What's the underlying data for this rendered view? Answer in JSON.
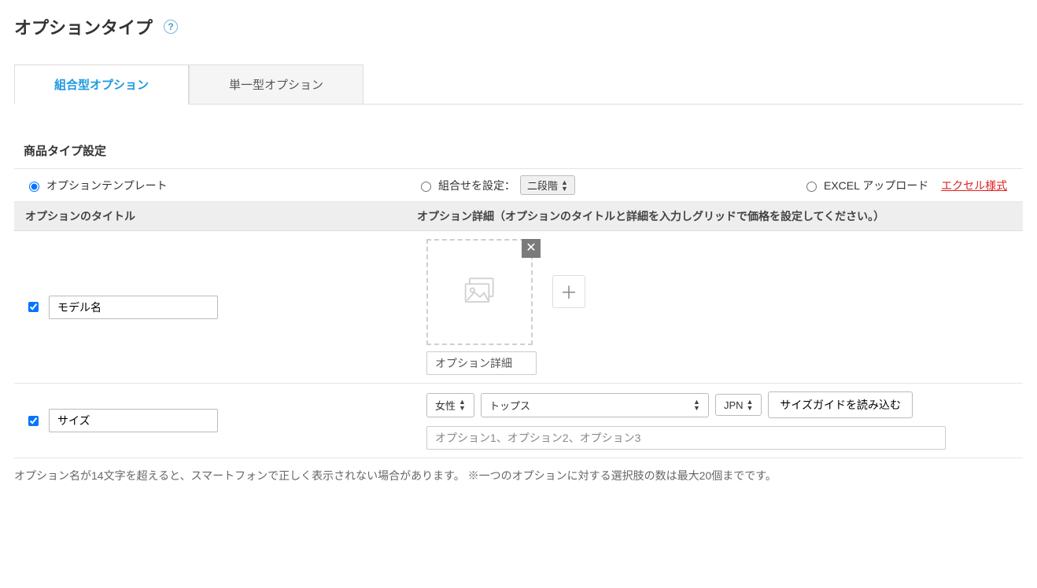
{
  "page_title": "オプションタイプ",
  "tabs": {
    "combo": "組合型オプション",
    "single": "単一型オプション"
  },
  "section_title": "商品タイプ設定",
  "config": {
    "template_label": "オプションテンプレート",
    "combine_label": "組合せを設定：",
    "combine_select_value": "二段階",
    "excel_label": "EXCEL アップロード",
    "excel_link": "エクセル様式"
  },
  "headers": {
    "title": "オプションのタイトル",
    "detail": "オプション詳細（オプションのタイトルと詳細を入力しグリッドで価格を設定してください。）"
  },
  "rows": {
    "model": {
      "title_value": "モデル名",
      "detail_value": "オプション詳細"
    },
    "size": {
      "title_value": "サイズ",
      "gender_select": "女性",
      "category_select": "トップス",
      "region_select": "JPN",
      "load_guide_btn": "サイズガイドを読み込む",
      "options_placeholder": "オプション1、オプション2、オプション3"
    }
  },
  "footnote": "オプション名が14文字を超えると、スマートフォンで正しく表示されない場合があります。 ※一つのオプションに対する選択肢の数は最大20個までです。"
}
